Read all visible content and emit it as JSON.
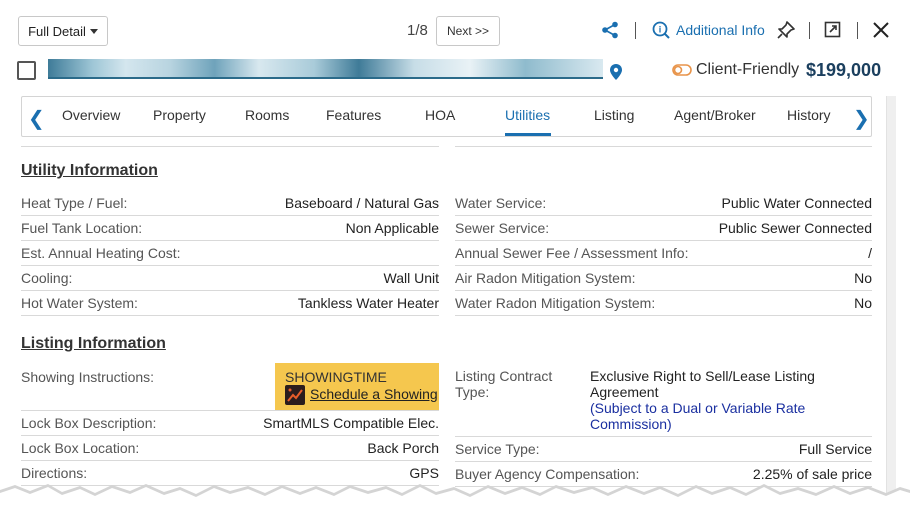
{
  "header": {
    "view_select": "Full Detail",
    "pager": "1/8",
    "next_label": "Next >>",
    "additional_info": "Additional Info",
    "client_friendly": "Client-Friendly",
    "price": "$199,000",
    "accent": "#1a6fb0"
  },
  "tabs": [
    "Overview",
    "Property",
    "Rooms",
    "Features",
    "HOA",
    "Utilities",
    "Listing",
    "Agent/Broker",
    "History"
  ],
  "active_tab": "Utilities",
  "utility": {
    "title": "Utility Information",
    "left": [
      {
        "label": "Heat Type / Fuel:",
        "value": "Baseboard / Natural Gas"
      },
      {
        "label": "Fuel Tank Location:",
        "value": "Non Applicable"
      },
      {
        "label": "Est. Annual Heating Cost:",
        "value": ""
      },
      {
        "label": "Cooling:",
        "value": "Wall Unit"
      },
      {
        "label": "Hot Water System:",
        "value": "Tankless Water Heater"
      }
    ],
    "right": [
      {
        "label": "Water Service:",
        "value": "Public Water Connected"
      },
      {
        "label": "Sewer Service:",
        "value": "Public Sewer Connected"
      },
      {
        "label": "Annual Sewer Fee / Assessment Info:",
        "value": "/"
      },
      {
        "label": "Air Radon Mitigation System:",
        "value": "No"
      },
      {
        "label": "Water Radon Mitigation System:",
        "value": "No"
      }
    ]
  },
  "listing": {
    "title": "Listing Information",
    "showing_label": "Showing Instructions:",
    "showing_box_title": "SHOWINGTIME",
    "showing_link": "Schedule a Showing",
    "contract_label": "Listing Contract Type:",
    "contract_value": "Exclusive Right to Sell/Lease Listing Agreement",
    "contract_link": "(Subject to a Dual or Variable Rate Commission)",
    "left": [
      {
        "label": "Lock Box Description:",
        "value": "SmartMLS Compatible Elec."
      },
      {
        "label": "Lock Box Location:",
        "value": "Back Porch"
      },
      {
        "label": "Directions:",
        "value": "GPS"
      }
    ],
    "right": [
      {
        "label": "Service Type:",
        "value": "Full Service"
      },
      {
        "label": "Buyer Agency Compensation:",
        "value": "2.25% of sale price"
      }
    ]
  }
}
